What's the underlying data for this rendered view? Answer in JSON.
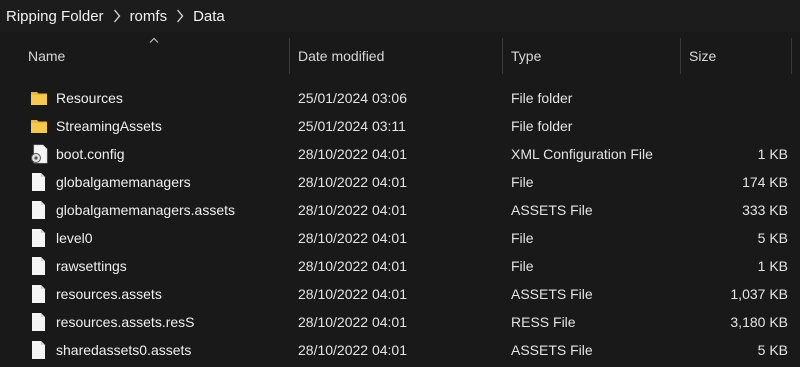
{
  "breadcrumb": [
    "Ripping Folder",
    "romfs",
    "Data"
  ],
  "columns": {
    "name": "Name",
    "date": "Date modified",
    "type": "Type",
    "size": "Size"
  },
  "files": [
    {
      "name": "Resources",
      "date": "25/01/2024 03:06",
      "type": "File folder",
      "size": "",
      "icon": "folder-icon"
    },
    {
      "name": "StreamingAssets",
      "date": "25/01/2024 03:11",
      "type": "File folder",
      "size": "",
      "icon": "folder-icon"
    },
    {
      "name": "boot.config",
      "date": "28/10/2022 04:01",
      "type": "XML Configuration File",
      "size": "1 KB",
      "icon": "config-file-icon"
    },
    {
      "name": "globalgamemanagers",
      "date": "28/10/2022 04:01",
      "type": "File",
      "size": "174 KB",
      "icon": "file-icon"
    },
    {
      "name": "globalgamemanagers.assets",
      "date": "28/10/2022 04:01",
      "type": "ASSETS File",
      "size": "333 KB",
      "icon": "file-icon"
    },
    {
      "name": "level0",
      "date": "28/10/2022 04:01",
      "type": "File",
      "size": "5 KB",
      "icon": "file-icon"
    },
    {
      "name": "rawsettings",
      "date": "28/10/2022 04:01",
      "type": "File",
      "size": "1 KB",
      "icon": "file-icon"
    },
    {
      "name": "resources.assets",
      "date": "28/10/2022 04:01",
      "type": "ASSETS File",
      "size": "1,037 KB",
      "icon": "file-icon"
    },
    {
      "name": "resources.assets.resS",
      "date": "28/10/2022 04:01",
      "type": "RESS File",
      "size": "3,180 KB",
      "icon": "file-icon"
    },
    {
      "name": "sharedassets0.assets",
      "date": "28/10/2022 04:01",
      "type": "ASSETS File",
      "size": "5 KB",
      "icon": "file-icon"
    }
  ],
  "colors": {
    "background": "#191919",
    "folder": "#e8b940",
    "file": "#f5f5f5"
  }
}
